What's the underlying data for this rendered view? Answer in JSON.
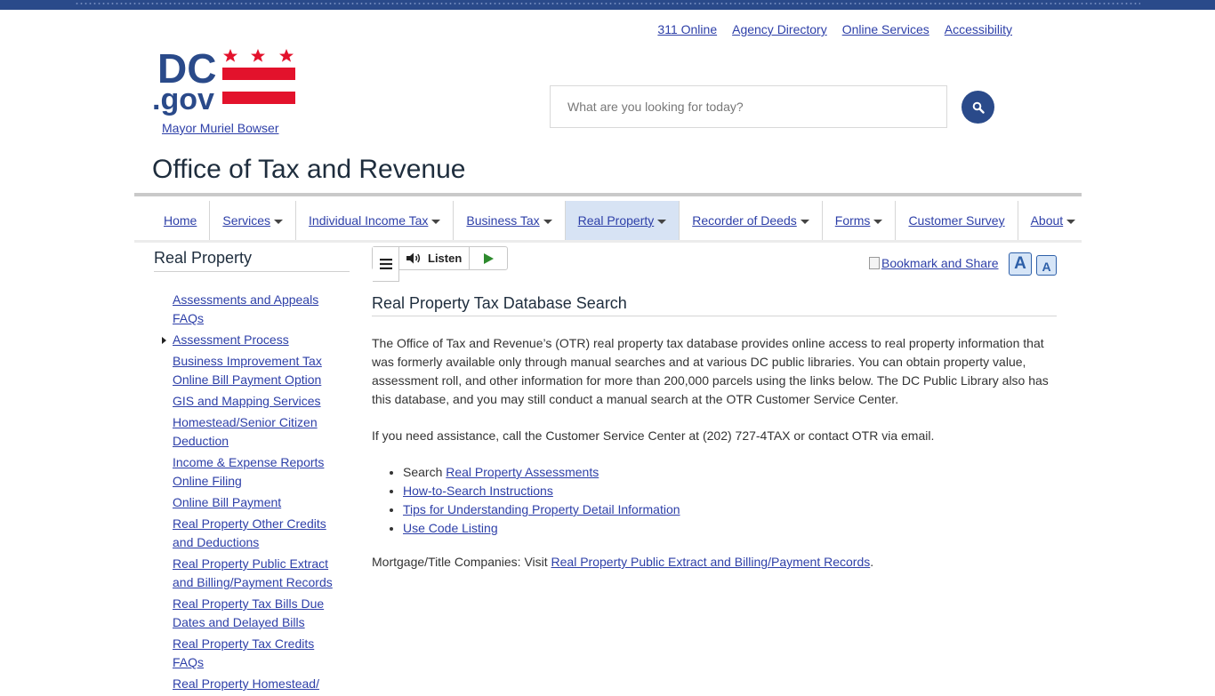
{
  "utility_links": [
    "311 Online",
    "Agency Directory",
    "Online Services",
    "Accessibility"
  ],
  "logo": {
    "text_dc": "DC",
    "text_gov": ".gov",
    "flag_red": "#e3122c",
    "text_blue": "#2a4a8a"
  },
  "mayor_link": "Mayor Muriel Bowser",
  "search": {
    "placeholder": "What are you looking for today?"
  },
  "office_title": "Office of Tax and Revenue",
  "nav": [
    {
      "label": "Home",
      "dropdown": false,
      "active": false
    },
    {
      "label": "Services",
      "dropdown": true,
      "active": false
    },
    {
      "label": "Individual Income Tax",
      "dropdown": true,
      "active": false
    },
    {
      "label": "Business Tax",
      "dropdown": true,
      "active": false
    },
    {
      "label": "Real Property",
      "dropdown": true,
      "active": true
    },
    {
      "label": "Recorder of Deeds",
      "dropdown": true,
      "active": false
    },
    {
      "label": "Forms",
      "dropdown": true,
      "active": false
    },
    {
      "label": "Customer Survey",
      "dropdown": false,
      "active": false
    },
    {
      "label": "About",
      "dropdown": true,
      "active": false
    }
  ],
  "sidebar": {
    "title": "Real Property",
    "items": [
      {
        "label": "Assessments and Appeals FAQs",
        "current": false
      },
      {
        "label": "Assessment Process",
        "current": true
      },
      {
        "label": "Business Improvement Tax Online Bill Payment Option",
        "current": false
      },
      {
        "label": "GIS and Mapping Services",
        "current": false
      },
      {
        "label": "Homestead/Senior Citizen Deduction",
        "current": false
      },
      {
        "label": "Income & Expense Reports Online Filing",
        "current": false
      },
      {
        "label": "Online Bill Payment",
        "current": false
      },
      {
        "label": "Real Property Other Credits and Deductions",
        "current": false
      },
      {
        "label": "Real Property Public Extract and Billing/Payment Records",
        "current": false
      },
      {
        "label": "Real Property Tax Bills Due Dates and Delayed Bills",
        "current": false
      },
      {
        "label": "Real Property Tax Credits FAQs",
        "current": false
      },
      {
        "label": "Real Property Homestead/",
        "current": false
      }
    ]
  },
  "listen": {
    "label": "Listen"
  },
  "bookmark": {
    "label": "Bookmark and Share"
  },
  "font_buttons": {
    "increase": "A",
    "decrease": "A"
  },
  "content": {
    "title": "Real Property Tax Database Search",
    "paragraph1": "The Office of Tax and Revenue’s (OTR) real property tax database provides online access to real property information that was formerly available only through manual searches and at various DC public libraries. You can obtain property value, assessment roll, and other information for more than 200,000 parcels using the links below. The DC Public Library also has this database, and you may still conduct a manual search at the OTR Customer Service Center.",
    "paragraph2": "If you need assistance, call the Customer Service Center at (202) 727-4TAX or contact OTR via email.",
    "bullets": [
      {
        "prefix": "Search ",
        "link": "Real Property Assessments"
      },
      {
        "prefix": "",
        "link": "How-to-Search Instructions"
      },
      {
        "prefix": "",
        "link": "Tips for Understanding Property Detail Information"
      },
      {
        "prefix": "",
        "link": "Use Code Listing"
      }
    ],
    "paragraph3_prefix": "Mortgage/Title Companies: Visit ",
    "paragraph3_link": "Real Property Public Extract and Billing/Payment Records",
    "paragraph3_suffix": "."
  }
}
